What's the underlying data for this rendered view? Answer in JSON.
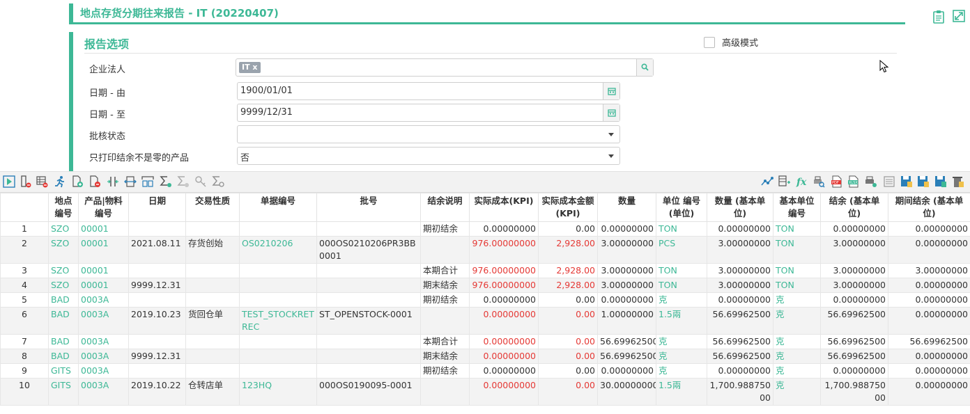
{
  "title": "地点存货分期往来报告 - IT (20220407)",
  "options": {
    "title": "报告选项",
    "advanced_label": "高级模式",
    "fields": [
      {
        "label": "企业法人",
        "tag": "IT x",
        "value": ""
      },
      {
        "label": "日期 - 由",
        "value": "1900/01/01"
      },
      {
        "label": "日期 - 至",
        "value": "9999/12/31"
      },
      {
        "label": "批核状态",
        "value": ""
      },
      {
        "label": "只打印结余不是零的产品",
        "value": "否"
      }
    ]
  },
  "table": {
    "headers": [
      "",
      "地点编号",
      "产品|物料编号",
      "日期",
      "交易性质",
      "单据编号",
      "批号",
      "结余说明",
      "实际成本(KPI)",
      "实际成本金额 (KPI)",
      "数量",
      "单位 编号 (单位)",
      "数量 (基本单位)",
      "基本单位编号",
      "结余 (基本单位)",
      "期间结余 (基本单位)"
    ],
    "rows": [
      [
        "1",
        "SZO",
        "00001",
        "",
        "",
        "",
        "",
        "期初结余",
        "0.00000000",
        "0.00",
        "0.00000000",
        "TON",
        "0.00000000",
        "TON",
        "0.00000000",
        "0.00000000"
      ],
      [
        "2",
        "SZO",
        "00001",
        "2021.08.11",
        "存货创始",
        "OS0210206",
        "000OS0210206PR3BB0001",
        "",
        "976.00000000",
        "2,928.00",
        "3.00000000",
        "PCS",
        "3.00000000",
        "TON",
        "3.00000000",
        "0.00000000"
      ],
      [
        "3",
        "SZO",
        "00001",
        "",
        "",
        "",
        "",
        "本期合计",
        "976.00000000",
        "2,928.00",
        "3.00000000",
        "TON",
        "3.00000000",
        "TON",
        "3.00000000",
        "3.00000000"
      ],
      [
        "4",
        "SZO",
        "00001",
        "9999.12.31",
        "",
        "",
        "",
        "期末结余",
        "976.00000000",
        "2,928.00",
        "3.00000000",
        "TON",
        "3.00000000",
        "TON",
        "3.00000000",
        "0.00000000"
      ],
      [
        "5",
        "BAD",
        "0003A",
        "",
        "",
        "",
        "",
        "期初结余",
        "0.00000000",
        "0.00",
        "0.00000000",
        "克",
        "0.00000000",
        "克",
        "0.00000000",
        "0.00000000"
      ],
      [
        "6",
        "BAD",
        "0003A",
        "2019.10.23",
        "货回仓单",
        "TEST_STOCKRETREC",
        "ST_OPENSTOCK-0001",
        "",
        "0.00000000",
        "0.00",
        "1.00000000",
        "1.5兩",
        "56.69962500",
        "克",
        "56.69962500",
        "0.00000000"
      ],
      [
        "7",
        "BAD",
        "0003A",
        "",
        "",
        "",
        "",
        "本期合计",
        "0.00000000",
        "0.00",
        "56.69962500",
        "克",
        "56.69962500",
        "克",
        "56.69962500",
        "56.69962500"
      ],
      [
        "8",
        "BAD",
        "0003A",
        "9999.12.31",
        "",
        "",
        "",
        "期末结余",
        "0.00000000",
        "0.00",
        "56.69962500",
        "克",
        "56.69962500",
        "克",
        "56.69962500",
        "0.00000000"
      ],
      [
        "9",
        "GITS",
        "0003A",
        "",
        "",
        "",
        "",
        "期初结余",
        "0.00000000",
        "0.00",
        "0.00000000",
        "克",
        "0.00000000",
        "克",
        "0.00000000",
        "0.00000000"
      ],
      [
        "10",
        "GITS",
        "0003A",
        "2019.10.22",
        "仓转店单",
        "123HQ",
        "000OS0190095-0001",
        "",
        "0.00000000",
        "0.00",
        "30.00000000",
        "1.5兩",
        "1,700.98875000",
        "克",
        "1,700.98875000",
        "0.00000000"
      ]
    ],
    "red_rows": [
      2,
      3,
      4,
      6,
      7,
      8,
      10
    ]
  },
  "colors": {
    "accent": "#3db896",
    "negative": "#e53935"
  }
}
